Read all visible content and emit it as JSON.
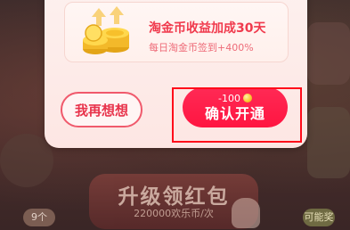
{
  "modal": {
    "benefit": {
      "title": "淘金币收益加成30天",
      "description": "每日淘金币签到+400%",
      "icon": "gold-coins-arrow-icon"
    },
    "cancel_button": {
      "label": "我再想想"
    },
    "confirm_button": {
      "cost": "-100",
      "cost_icon": "coin-icon",
      "label": "确认开通"
    }
  },
  "background": {
    "cta_title": "升级领红包",
    "cta_subtitle": "220000欢乐币/次",
    "badge_left": "9个",
    "badge_right": "可能奖"
  },
  "colors": {
    "primary": "#ff1f4b",
    "accent_text": "#f03a4d",
    "highlight": "#ff0a1a"
  }
}
